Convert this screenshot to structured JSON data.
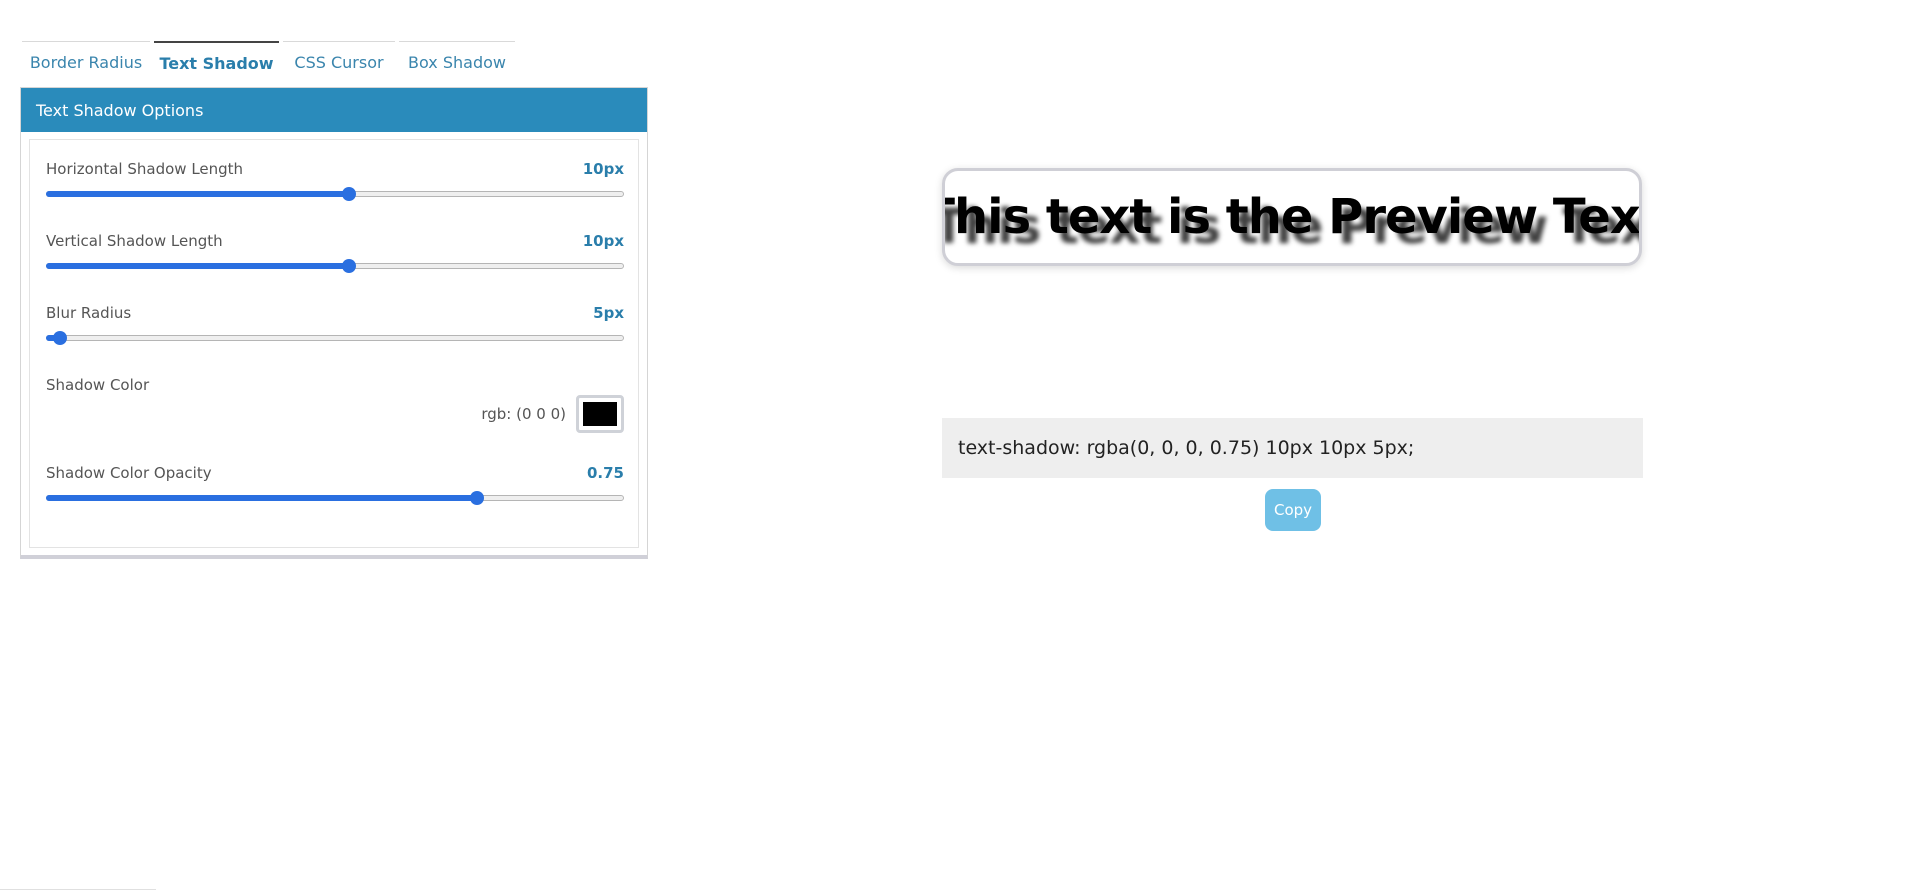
{
  "tabs": [
    {
      "label": "Border Radius",
      "active": false
    },
    {
      "label": "Text Shadow",
      "active": true
    },
    {
      "label": "CSS Cursor",
      "active": false
    },
    {
      "label": "Box Shadow",
      "active": false
    }
  ],
  "panel": {
    "title": "Text Shadow Options",
    "controls": {
      "horizontal": {
        "label": "Horizontal Shadow Length",
        "value_text": "10px",
        "fraction": 0.525
      },
      "vertical": {
        "label": "Vertical Shadow Length",
        "value_text": "10px",
        "fraction": 0.525
      },
      "blur": {
        "label": "Blur Radius",
        "value_text": "5px",
        "fraction": 0.025
      },
      "color": {
        "label": "Shadow Color",
        "rgb_text": "rgb: (0 0 0)",
        "swatch": "#000000"
      },
      "opacity": {
        "label": "Shadow Color Opacity",
        "value_text": "0.75",
        "fraction": 0.745
      }
    }
  },
  "preview": {
    "text": "This text is the Preview Text",
    "text_shadow": "rgba(0, 0, 0, 0.75) 10px 10px 5px"
  },
  "code": {
    "css": "text-shadow: rgba(0, 0, 0, 0.75) 10px 10px 5px;"
  },
  "copy_label": "Copy",
  "colors": {
    "accent": "#2a8bbb",
    "slider": "#2a6fe0",
    "link": "#2a7eab",
    "copy_button": "#6fc0e6"
  }
}
